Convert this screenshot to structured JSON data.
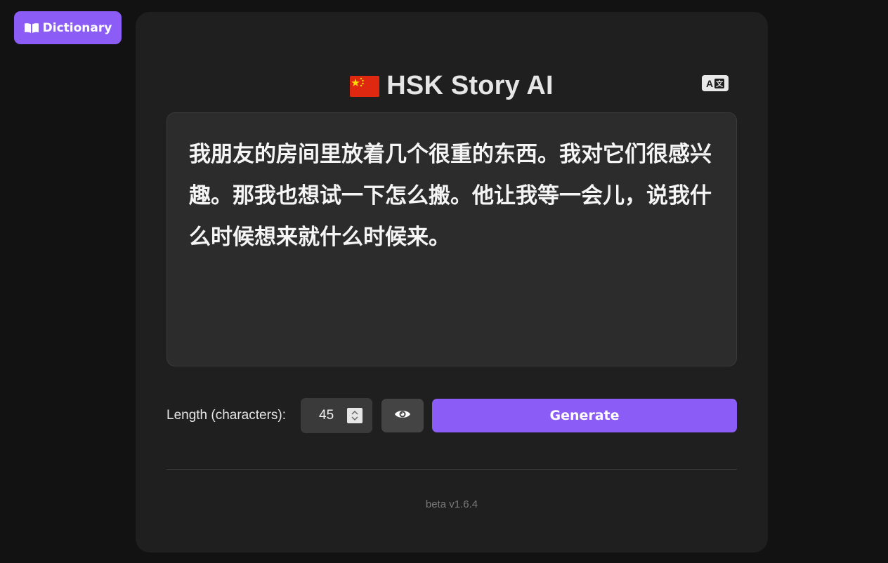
{
  "dictionary_button": {
    "label": "Dictionary",
    "icon": "book-icon"
  },
  "app": {
    "title": "HSK Story AI",
    "flag_icon": "china-flag-icon",
    "translate_icon": "translate-icon",
    "translate_glyph_a": "A",
    "translate_glyph_b": "文"
  },
  "story": {
    "text": "我朋友的房间里放着几个很重的东西。我对它们很感兴趣。那我也想试一下怎么搬。他让我等一会儿，说我什么时候想来就什么时候来。"
  },
  "controls": {
    "length_label": "Length (characters):",
    "length_value": "45",
    "eye_icon": "eye-icon",
    "generate_label": "Generate"
  },
  "footer": {
    "version": "beta v1.6.4"
  },
  "colors": {
    "accent": "#8b5cf6",
    "background": "#121212",
    "card": "#1f1f1f",
    "story_box": "#2c2c2c",
    "flag_red": "#de2910",
    "flag_yellow": "#ffde00"
  }
}
